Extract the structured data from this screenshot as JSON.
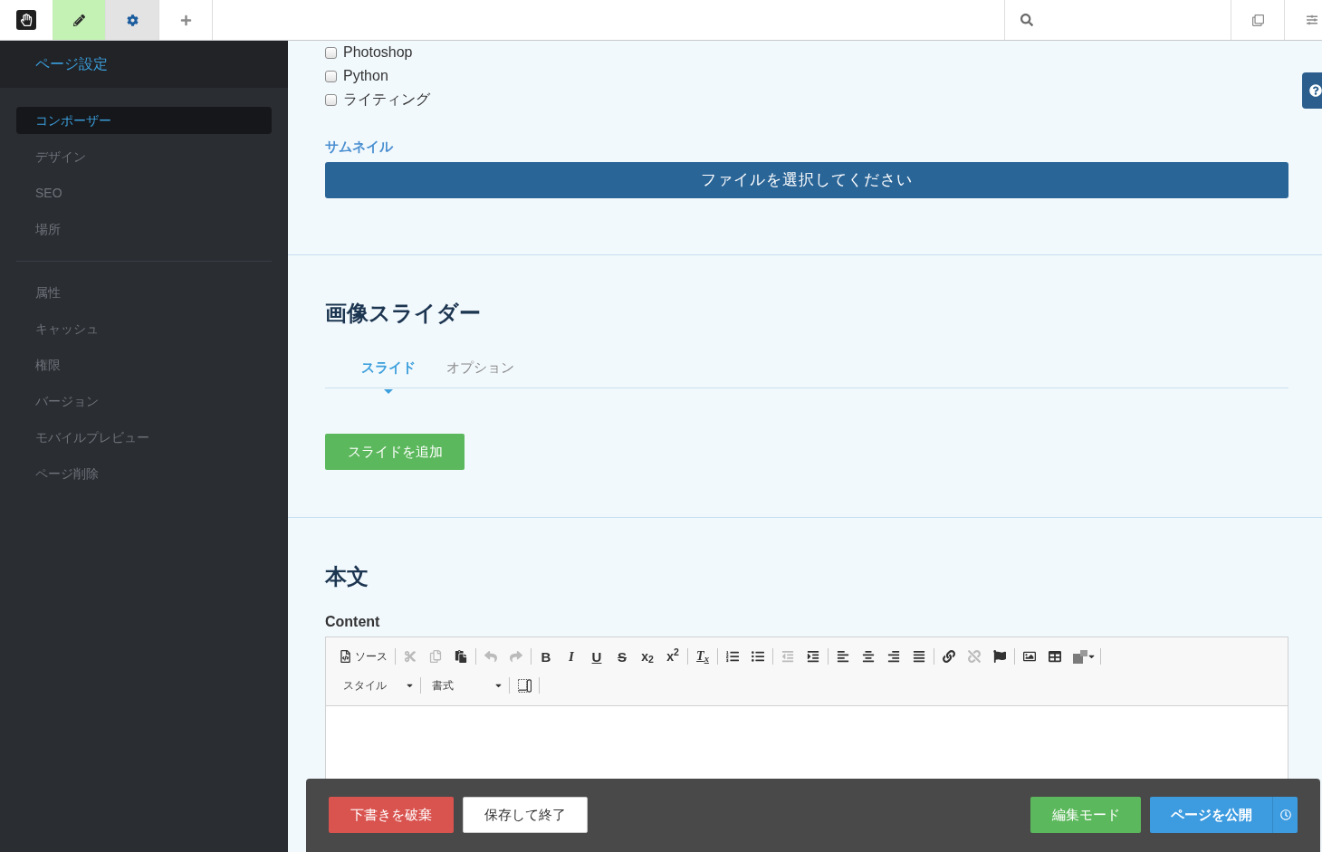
{
  "top_bar": {
    "tools": [
      {
        "kind": "edit",
        "active": true
      },
      {
        "kind": "settings",
        "active": true
      },
      {
        "kind": "add",
        "active": false
      }
    ]
  },
  "sidebar": {
    "title": "ページ設定",
    "groups": [
      {
        "items": [
          {
            "label": "コンポーザー",
            "selected": true
          },
          {
            "label": "デザイン",
            "selected": false
          },
          {
            "label": "SEO",
            "selected": false
          },
          {
            "label": "場所",
            "selected": false
          }
        ]
      },
      {
        "items": [
          {
            "label": "属性",
            "selected": false
          },
          {
            "label": "キャッシュ",
            "selected": false
          },
          {
            "label": "権限",
            "selected": false
          },
          {
            "label": "バージョン",
            "selected": false
          },
          {
            "label": "モバイルプレビュー",
            "selected": false
          },
          {
            "label": "ページ削除",
            "selected": false
          }
        ]
      }
    ]
  },
  "checkbox_options": [
    {
      "label": "Photoshop",
      "checked": false
    },
    {
      "label": "Python",
      "checked": false
    },
    {
      "label": "ライティング",
      "checked": false
    }
  ],
  "thumbnail": {
    "label": "サムネイル",
    "button": "ファイルを選択してください"
  },
  "image_slider": {
    "title": "画像スライダー",
    "tabs": [
      {
        "label": "スライド",
        "selected": true
      },
      {
        "label": "オプション",
        "selected": false
      }
    ],
    "add_button": "スライドを追加"
  },
  "body": {
    "title": "本文",
    "field_label": "Content",
    "editor": {
      "toolbar_rows": [
        {
          "groups": [
            {
              "buttons": [
                {
                  "kind": "source",
                  "label": "ソース",
                  "disabled": false
                }
              ]
            },
            {
              "buttons": [
                {
                  "kind": "cut",
                  "disabled": true
                },
                {
                  "kind": "copy",
                  "disabled": true
                },
                {
                  "kind": "paste",
                  "disabled": false
                }
              ]
            },
            {
              "buttons": [
                {
                  "kind": "undo",
                  "disabled": true
                },
                {
                  "kind": "redo",
                  "disabled": true
                }
              ]
            },
            {
              "buttons": [
                {
                  "kind": "bold",
                  "label": "B",
                  "disabled": false
                },
                {
                  "kind": "italic",
                  "label": "I",
                  "disabled": false
                },
                {
                  "kind": "underline",
                  "label": "U",
                  "disabled": false
                },
                {
                  "kind": "strike",
                  "label": "S",
                  "disabled": false
                },
                {
                  "kind": "subscript",
                  "label": "x$_{2}$",
                  "disabled": false
                },
                {
                  "kind": "superscript",
                  "label": "x$^{2}$",
                  "disabled": false
                }
              ]
            },
            {
              "buttons": [
                {
                  "kind": "removeformat",
                  "label": "T$_{x}$",
                  "disabled": false
                }
              ]
            },
            {
              "buttons": [
                {
                  "kind": "numberedlist",
                  "disabled": false
                },
                {
                  "kind": "bulletedlist",
                  "disabled": false
                }
              ]
            },
            {
              "buttons": [
                {
                  "kind": "outdent",
                  "disabled": true
                },
                {
                  "kind": "indent",
                  "disabled": false
                }
              ]
            },
            {
              "buttons": [
                {
                  "kind": "alignleft",
                  "disabled": false
                },
                {
                  "kind": "aligncenter",
                  "disabled": false
                },
                {
                  "kind": "alignright",
                  "disabled": false
                },
                {
                  "kind": "justify",
                  "disabled": false
                }
              ]
            },
            {
              "buttons": [
                {
                  "kind": "link",
                  "disabled": false
                },
                {
                  "kind": "unlink",
                  "disabled": true
                },
                {
                  "kind": "anchor",
                  "disabled": false
                }
              ]
            },
            {
              "buttons": [
                {
                  "kind": "image",
                  "disabled": false
                },
                {
                  "kind": "table",
                  "disabled": false
                },
                {
                  "kind": "blocks",
                  "disabled": false
                }
              ]
            }
          ]
        },
        {
          "groups": [
            {
              "buttons": [
                {
                  "kind": "combo",
                  "label": "スタイル",
                  "disabled": false
                }
              ]
            },
            {
              "buttons": [
                {
                  "kind": "combo",
                  "label": "書式",
                  "disabled": false
                }
              ]
            },
            {
              "buttons": [
                {
                  "kind": "showblocks",
                  "disabled": false
                }
              ]
            }
          ]
        }
      ]
    }
  },
  "footer": {
    "left_buttons": [
      {
        "label": "下書きを破棄",
        "kind": "danger"
      },
      {
        "label": "保存して終了",
        "kind": "default"
      }
    ],
    "right_buttons": [
      {
        "label": "編集モード",
        "kind": "success"
      },
      {
        "label": "ページを公開",
        "kind": "publish"
      }
    ]
  }
}
